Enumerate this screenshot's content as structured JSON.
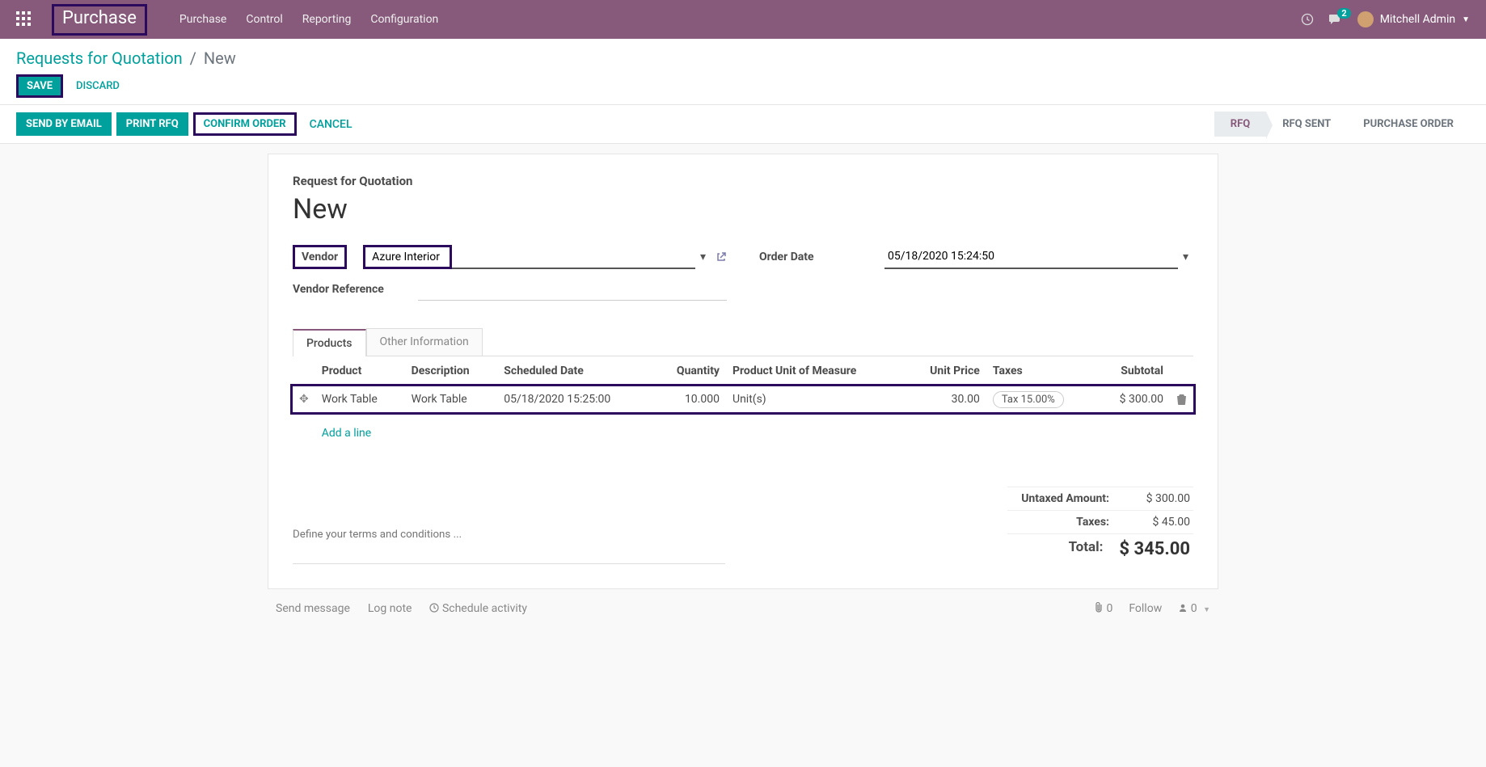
{
  "nav": {
    "brand": "Purchase",
    "items": [
      "Purchase",
      "Control",
      "Reporting",
      "Configuration"
    ],
    "conversation_badge": "2",
    "user_name": "Mitchell Admin"
  },
  "breadcrumb": {
    "parent": "Requests for Quotation",
    "current": "New"
  },
  "buttons": {
    "save": "SAVE",
    "discard": "DISCARD",
    "send_email": "SEND BY EMAIL",
    "print_rfq": "PRINT RFQ",
    "confirm_order": "CONFIRM ORDER",
    "cancel": "CANCEL"
  },
  "status_steps": [
    "RFQ",
    "RFQ SENT",
    "PURCHASE ORDER"
  ],
  "form": {
    "doc_type": "Request for Quotation",
    "doc_name": "New",
    "vendor_label": "Vendor",
    "vendor_value": "Azure Interior",
    "vendor_ref_label": "Vendor Reference",
    "vendor_ref_value": "",
    "order_date_label": "Order Date",
    "order_date_value": "05/18/2020 15:24:50"
  },
  "tabs": {
    "products": "Products",
    "other": "Other Information"
  },
  "table": {
    "headers": {
      "product": "Product",
      "description": "Description",
      "scheduled": "Scheduled Date",
      "quantity": "Quantity",
      "uom": "Product Unit of Measure",
      "unit_price": "Unit Price",
      "taxes": "Taxes",
      "subtotal": "Subtotal"
    },
    "row": {
      "product": "Work Table",
      "description": "Work Table",
      "scheduled": "05/18/2020 15:25:00",
      "quantity": "10.000",
      "uom": "Unit(s)",
      "unit_price": "30.00",
      "tax": "Tax 15.00%",
      "subtotal": "$ 300.00"
    },
    "add_line": "Add a line"
  },
  "terms_placeholder": "Define your terms and conditions ...",
  "totals": {
    "untaxed_label": "Untaxed Amount:",
    "untaxed_value": "$ 300.00",
    "taxes_label": "Taxes:",
    "taxes_value": "$ 45.00",
    "total_label": "Total:",
    "total_value": "$ 345.00"
  },
  "chat": {
    "send_message": "Send message",
    "log_note": "Log note",
    "schedule": "Schedule activity",
    "attachments": "0",
    "follow": "Follow",
    "followers": "0"
  }
}
